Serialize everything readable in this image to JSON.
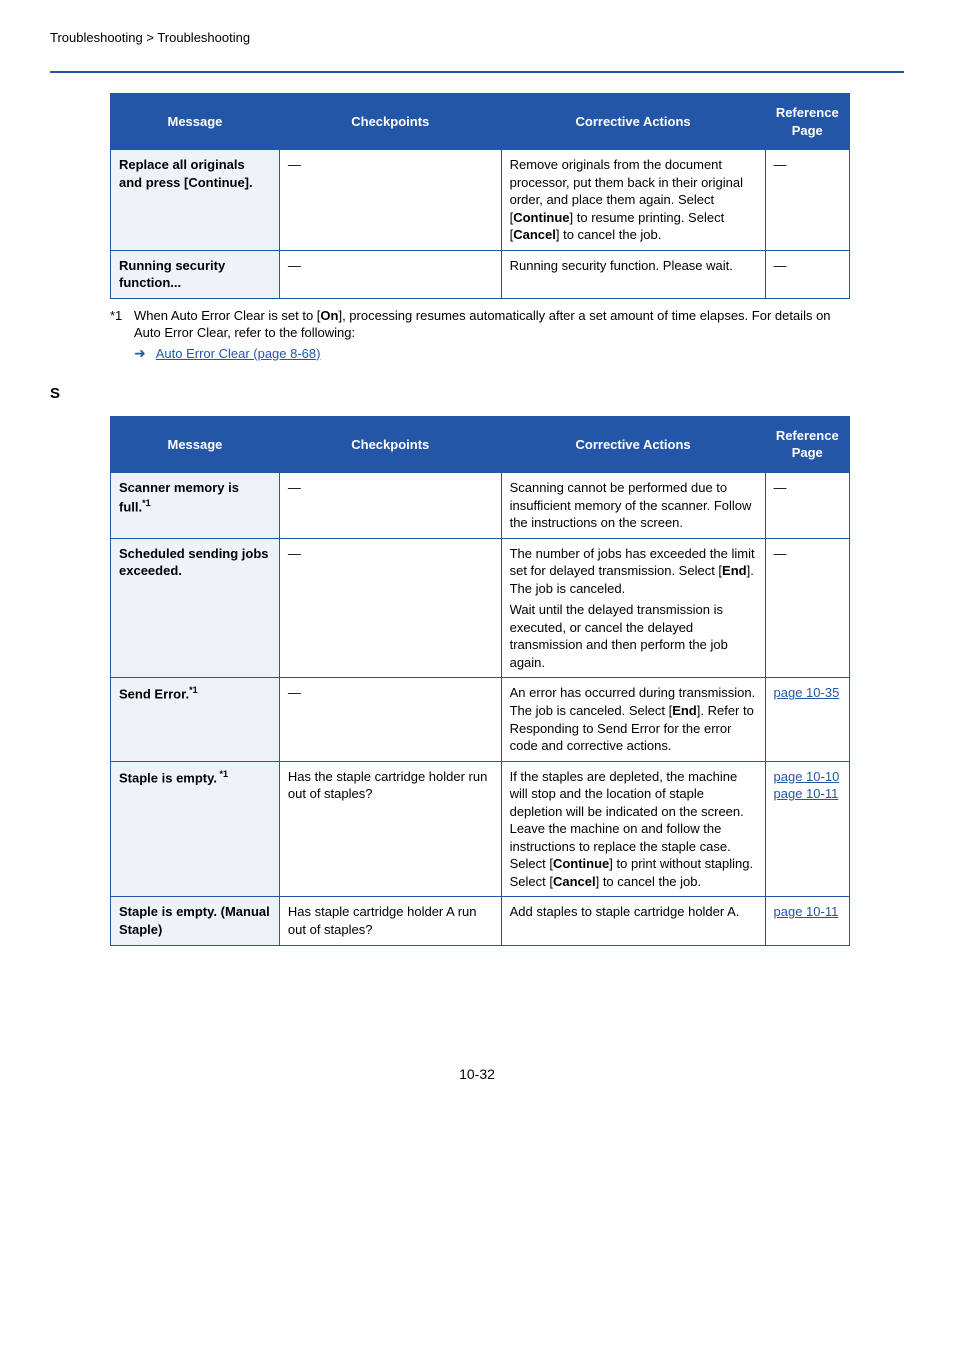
{
  "breadcrumb": "Troubleshooting > Troubleshooting",
  "table1": {
    "headers": [
      "Message",
      "Checkpoints",
      "Corrective Actions",
      "Reference Page"
    ],
    "rows": [
      {
        "message": "Replace all originals and press [Continue].",
        "checkpoints": "―",
        "actions": "Remove originals from the document processor, put them back in their original order, and place them again. Select [Continue] to resume printing. Select [Cancel] to cancel the job.",
        "ref": "―"
      },
      {
        "message": "Running security function...",
        "checkpoints": "―",
        "actions": "Running security function. Please wait.",
        "ref": "―"
      }
    ]
  },
  "footnote1": {
    "mark": "*1",
    "text": "When Auto Error Clear is set to [On], processing resumes automatically after a set amount of time elapses. For details on Auto Error Clear, refer to the following:",
    "link": "Auto Error Clear (page 8-68)"
  },
  "section_letter": "S",
  "table2": {
    "headers": [
      "Message",
      "Checkpoints",
      "Corrective Actions",
      "Reference Page"
    ],
    "rows": [
      {
        "message_html": "Scanner memory is full.",
        "sup": "*1",
        "checkpoints": "―",
        "actions": "Scanning cannot be performed due to insufficient memory of the scanner. Follow the instructions on the screen.",
        "ref": "―"
      },
      {
        "message_html": "Scheduled sending jobs exceeded.",
        "sup": "",
        "checkpoints": "―",
        "actions_p1": "The number of jobs has exceeded the limit set for delayed transmission. Select [End]. The job is canceled.",
        "actions_p2": "Wait until the delayed transmission is executed, or cancel the delayed transmission and then perform the job again.",
        "ref": "―"
      },
      {
        "message_html": "Send Error.",
        "sup": "*1",
        "checkpoints": "―",
        "actions": "An error has occurred during transmission. The job is canceled. Select [End]. Refer to Responding to Send Error for the error code and corrective actions.",
        "ref_link": "page 10-35"
      },
      {
        "message_html": "Staple is empty.",
        "sup": " *1",
        "checkpoints": "Has the staple cartridge holder run out of staples?",
        "actions": "If the staples are depleted, the machine will stop and the location of staple depletion will be indicated on the screen. Leave the machine on and follow the instructions to replace the staple case. Select [Continue] to print without stapling. Select [Cancel] to cancel the job.",
        "ref_link1": "page 10-10",
        "ref_link2": "page 10-11"
      },
      {
        "message_html": "Staple is empty. (Manual Staple)",
        "sup": "",
        "checkpoints": "Has staple cartridge holder A run out of staples?",
        "actions": "Add staples to staple cartridge holder A.",
        "ref_link": "page 10-11"
      }
    ]
  },
  "page_number": "10-32",
  "chart_data": [
    {
      "type": "table",
      "title": "Troubleshooting Messages (R)",
      "columns": [
        "Message",
        "Checkpoints",
        "Corrective Actions",
        "Reference Page"
      ],
      "rows": [
        [
          "Replace all originals and press [Continue].",
          "―",
          "Remove originals from the document processor, put them back in their original order, and place them again. Select [Continue] to resume printing. Select [Cancel] to cancel the job.",
          "―"
        ],
        [
          "Running security function...",
          "―",
          "Running security function. Please wait.",
          "―"
        ]
      ]
    },
    {
      "type": "table",
      "title": "Troubleshooting Messages (S)",
      "columns": [
        "Message",
        "Checkpoints",
        "Corrective Actions",
        "Reference Page"
      ],
      "rows": [
        [
          "Scanner memory is full.*1",
          "―",
          "Scanning cannot be performed due to insufficient memory of the scanner. Follow the instructions on the screen.",
          "―"
        ],
        [
          "Scheduled sending jobs exceeded.",
          "―",
          "The number of jobs has exceeded the limit set for delayed transmission. Select [End]. The job is canceled. Wait until the delayed transmission is executed, or cancel the delayed transmission and then perform the job again.",
          "―"
        ],
        [
          "Send Error.*1",
          "―",
          "An error has occurred during transmission. The job is canceled. Select [End]. Refer to Responding to Send Error for the error code and corrective actions.",
          "page 10-35"
        ],
        [
          "Staple is empty. *1",
          "Has the staple cartridge holder run out of staples?",
          "If the staples are depleted, the machine will stop and the location of staple depletion will be indicated on the screen. Leave the machine on and follow the instructions to replace the staple case. Select [Continue] to print without stapling. Select [Cancel] to cancel the job.",
          "page 10-10 page 10-11"
        ],
        [
          "Staple is empty. (Manual Staple)",
          "Has staple cartridge holder A run out of staples?",
          "Add staples to staple cartridge holder A.",
          "page 10-11"
        ]
      ]
    }
  ]
}
